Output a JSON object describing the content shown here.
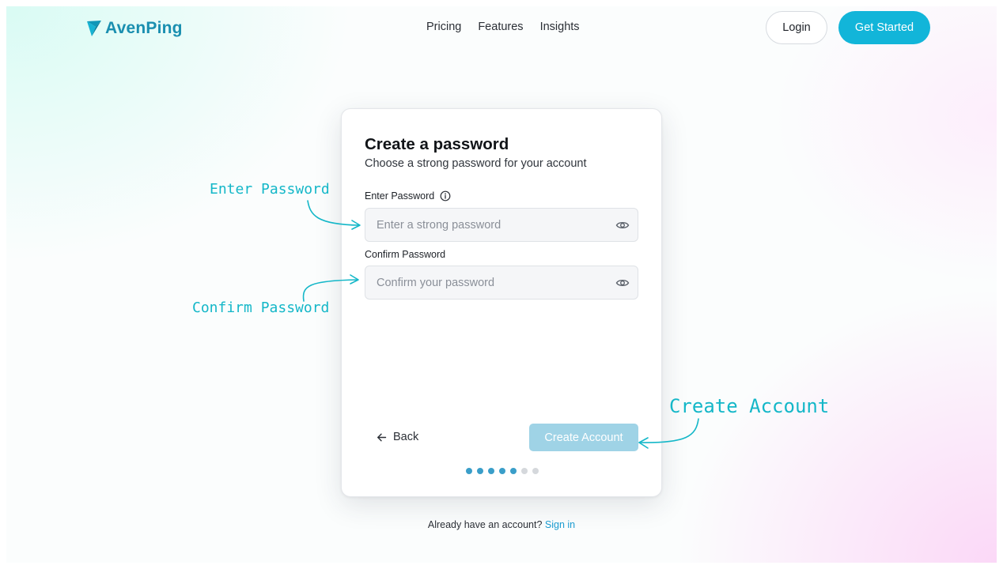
{
  "brand": {
    "name": "AvenPing",
    "color": "#1a8fb0"
  },
  "nav": {
    "links": [
      "Pricing",
      "Features",
      "Insights"
    ],
    "login_label": "Login",
    "get_started_label": "Get Started"
  },
  "form": {
    "title": "Create a password",
    "subtitle": "Choose a strong password for your account",
    "password_label": "Enter Password",
    "password_placeholder": "Enter a strong password",
    "password_value": "",
    "confirm_label": "Confirm Password",
    "confirm_placeholder": "Confirm your password",
    "confirm_value": "",
    "back_label": "Back",
    "create_label": "Create Account",
    "create_enabled": false,
    "steps_total": 7,
    "steps_active": 5
  },
  "footer": {
    "prompt": "Already have an account?",
    "sign_in_label": "Sign in"
  },
  "annotations": {
    "enter_password": "Enter Password",
    "confirm_password": "Confirm Password",
    "create_account": "Create Account"
  },
  "icons": {
    "logo": "logo-icon",
    "info": "info-icon",
    "eye": "eye-icon",
    "back": "arrow-left-icon"
  },
  "colors": {
    "accent": "#12b5d9",
    "create_disabled": "#9fd3e6",
    "annotation": "#14b7c8",
    "step_active": "#3a9ec9",
    "step_inactive": "#d5d8dc",
    "link": "#1a9bd0"
  }
}
